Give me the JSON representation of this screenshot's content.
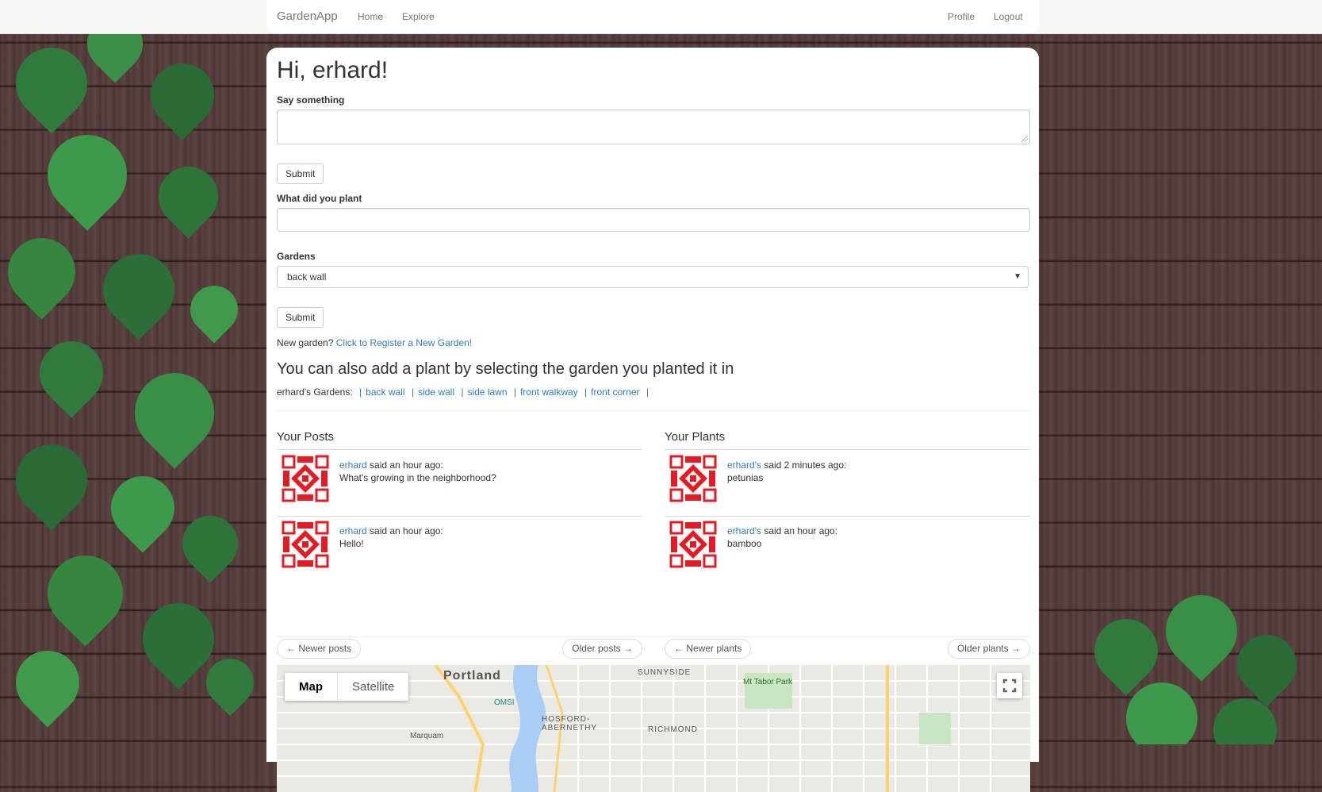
{
  "nav": {
    "brand": "GardenApp",
    "links": [
      "Home",
      "Explore"
    ],
    "right_links": [
      "Profile",
      "Logout"
    ]
  },
  "greeting": "Hi, erhard!",
  "post_form": {
    "label": "Say something",
    "value": "",
    "submit": "Submit"
  },
  "plant_form": {
    "label": "What did you plant",
    "value": "",
    "gardens_label": "Gardens",
    "selected_garden": "back wall",
    "submit": "Submit"
  },
  "new_garden": {
    "prefix": "New garden?",
    "link": "Click to Register a New Garden!"
  },
  "add_plant_heading": "You can also add a plant by selecting the garden you planted it in",
  "gardens_list": {
    "prefix": "erhard's Gardens:",
    "items": [
      "back wall",
      "side wall",
      "side lawn",
      "front walkway",
      "front corner"
    ]
  },
  "posts": {
    "title": "Your Posts",
    "items": [
      {
        "author": "erhard",
        "when": "said an hour ago:",
        "text": "What's growing in the neighborhood?"
      },
      {
        "author": "erhard",
        "when": "said an hour ago:",
        "text": "Hello!"
      }
    ],
    "newer": "← Newer posts",
    "older": "Older posts →"
  },
  "plants": {
    "title": "Your Plants",
    "items": [
      {
        "author": "erhard's",
        "when": "said 2 minutes ago:",
        "text": "petunias"
      },
      {
        "author": "erhard's",
        "when": "said an hour ago:",
        "text": "bamboo"
      }
    ],
    "newer": "← Newer plants",
    "older": "Older plants →"
  },
  "map": {
    "tab_map": "Map",
    "tab_satellite": "Satellite",
    "labels": [
      "Portland",
      "SUNNYSIDE",
      "Mt Tabor Park",
      "HOSFORD-ABERNETHY",
      "RICHMOND",
      "OMSI",
      "Marquam"
    ]
  },
  "colors": {
    "link": "#337ab7",
    "avatar": "#e31b23"
  }
}
